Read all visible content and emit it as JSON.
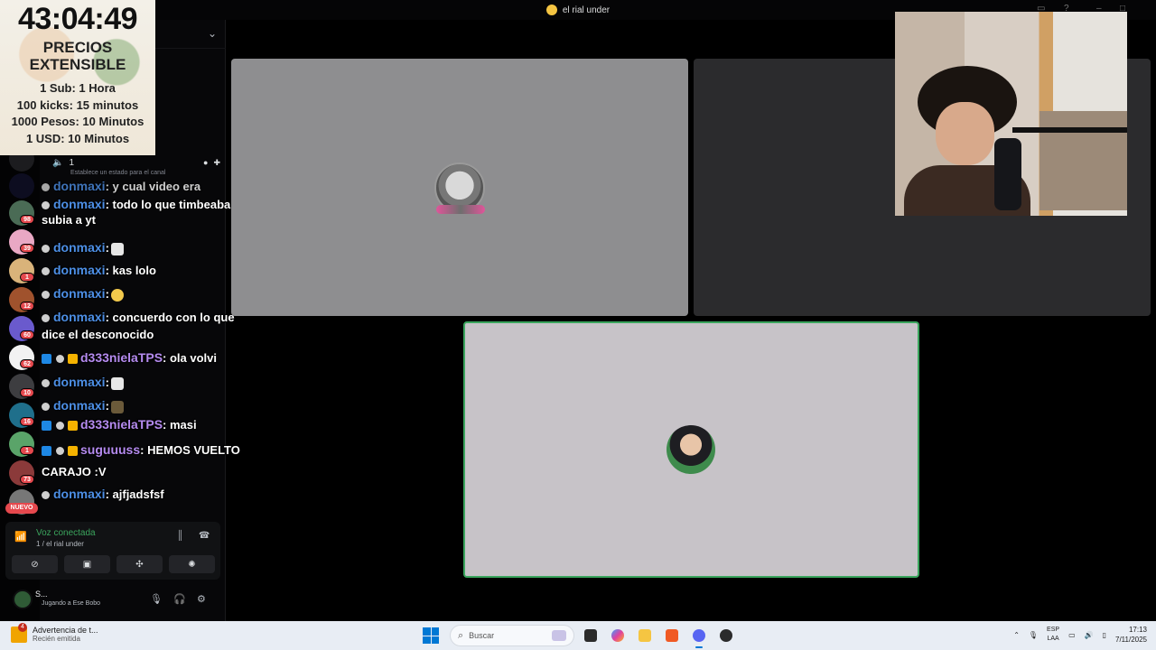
{
  "window": {
    "title": "el rial under"
  },
  "overlay": {
    "timer": "43:04:49",
    "heading_line1": "PRECIOS",
    "heading_line2": "EXTENSIBLE",
    "prices": [
      "1 Sub: 1 Hora",
      "100 kicks: 15 minutos",
      "1000 Pesos: 10 Minutos",
      "1 USD: 10 Minutos"
    ]
  },
  "sidebar": {
    "voice_user_count": "1",
    "status_hint": "Establece un estado para el canal",
    "server_badges": [
      "98",
      "39",
      "1",
      "12",
      "60",
      "62",
      "10",
      "16",
      "1",
      "73"
    ],
    "nuevo_label": "NUEVO"
  },
  "voice_panel": {
    "status": "Voz conectada",
    "channel": "1 / el rial under"
  },
  "user_panel": {
    "name": "S...",
    "activity": "Jugando a Ese Bobo"
  },
  "chat": {
    "messages": [
      {
        "user": "donmaxi",
        "text": ": y cual video era"
      },
      {
        "user": "donmaxi",
        "text": ": todo lo que timbeaba lo"
      },
      {
        "user": "",
        "text": "subia a yt"
      },
      {
        "user": "donmaxi",
        "text": ":"
      },
      {
        "user": "donmaxi",
        "text": ":   kas   lolo"
      },
      {
        "user": "donmaxi",
        "text": ":"
      },
      {
        "user": "donmaxi",
        "text": ": concuerdo con lo que"
      },
      {
        "user": "",
        "text": "dice el desconocido"
      },
      {
        "user": "d333nielaTPS",
        "text": ": ola volvi"
      },
      {
        "user": "donmaxi",
        "text": ":"
      },
      {
        "user": "donmaxi",
        "text": ":"
      },
      {
        "user": "d333nielaTPS",
        "text": ":   masi"
      },
      {
        "user": "suguuuss",
        "text": ": HEMOS VUELTO"
      },
      {
        "user": "",
        "text": "CARAJO :V"
      },
      {
        "user": "donmaxi",
        "text": ": ajfjadsfsf"
      }
    ]
  },
  "taskbar": {
    "notification_title": "Advertencia de t...",
    "notification_sub": "Recién emitida",
    "notification_count": "4",
    "search_placeholder": "Buscar",
    "lang_line1": "ESP",
    "lang_line2": "LAA",
    "time": "17:13",
    "date": "7/11/2025"
  },
  "colors": {
    "speaking_border": "#3aa55d",
    "username_blue": "#4d8fe6",
    "username_purple": "#b58bf0",
    "badge_red": "#e5484d"
  }
}
